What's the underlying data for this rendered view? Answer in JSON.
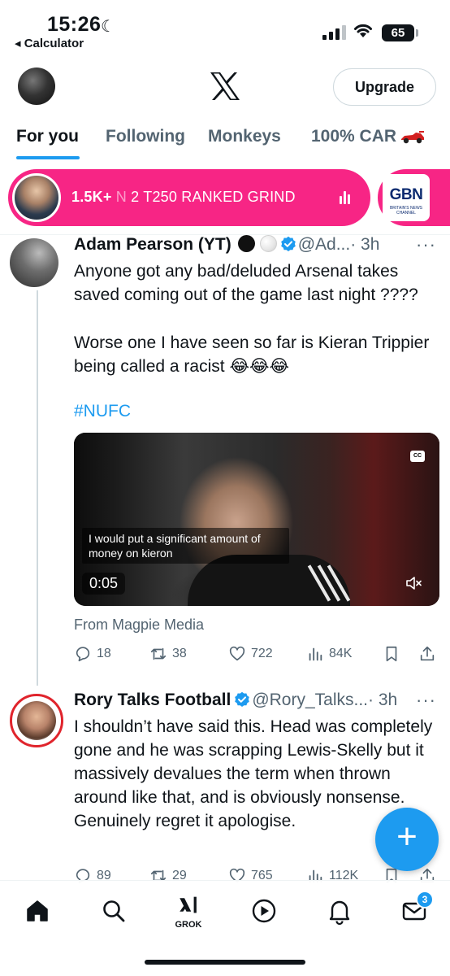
{
  "status_bar": {
    "time": "15:26",
    "back_app": "◂ Calculator",
    "battery": "65"
  },
  "header": {
    "upgrade_label": "Upgrade"
  },
  "tabs": [
    {
      "label": "For you",
      "active": true
    },
    {
      "label": "Following",
      "active": false
    },
    {
      "label": "Monkeys",
      "active": false
    },
    {
      "label": "100% CAR",
      "active": false
    }
  ],
  "spaces": {
    "count": "1.5K+",
    "title_faded": "N",
    "title_rest": "2 T250 RANKED GRIND",
    "second_logo": "GBN",
    "second_logo_sub": "BRITAIN'S NEWS CHANNEL"
  },
  "tweets": [
    {
      "name": "Adam Pearson (YT)",
      "handle": "@Ad...",
      "time": "· 3h",
      "text_1": "Anyone got any bad/deluded Arsenal takes saved coming out of the game last night ????",
      "text_2": "Worse one I have seen so far is Kieran Trippier being called a racist 😂😂😂",
      "hashtag": "#NUFC",
      "video": {
        "subtitle": "I would put a significant amount of money on kieron",
        "time": "0:05",
        "cc": "CC"
      },
      "source": "From Magpie Media",
      "stats": {
        "replies": "18",
        "reposts": "38",
        "likes": "722",
        "views": "84K"
      }
    },
    {
      "name": "Rory Talks Football",
      "handle": "@Rory_Talks...",
      "time": "· 3h",
      "text": "I shouldn’t have said this. Head was completely gone and he was scrapping Lewis-Skelly but it massively devalues the term when thrown around like that, and is obviously nonsense. Genuinely regret it apologise.",
      "stats": {
        "replies": "89",
        "reposts": "29",
        "likes": "765",
        "views": "112K"
      }
    }
  ],
  "fab_label": "+",
  "bottom_nav": {
    "grok_label": "GROK",
    "messages_badge": "3"
  },
  "colors": {
    "accent": "#1d9bf0",
    "spaces_pink": "#f72585",
    "text_primary": "#0f1419",
    "text_secondary": "#536471"
  }
}
